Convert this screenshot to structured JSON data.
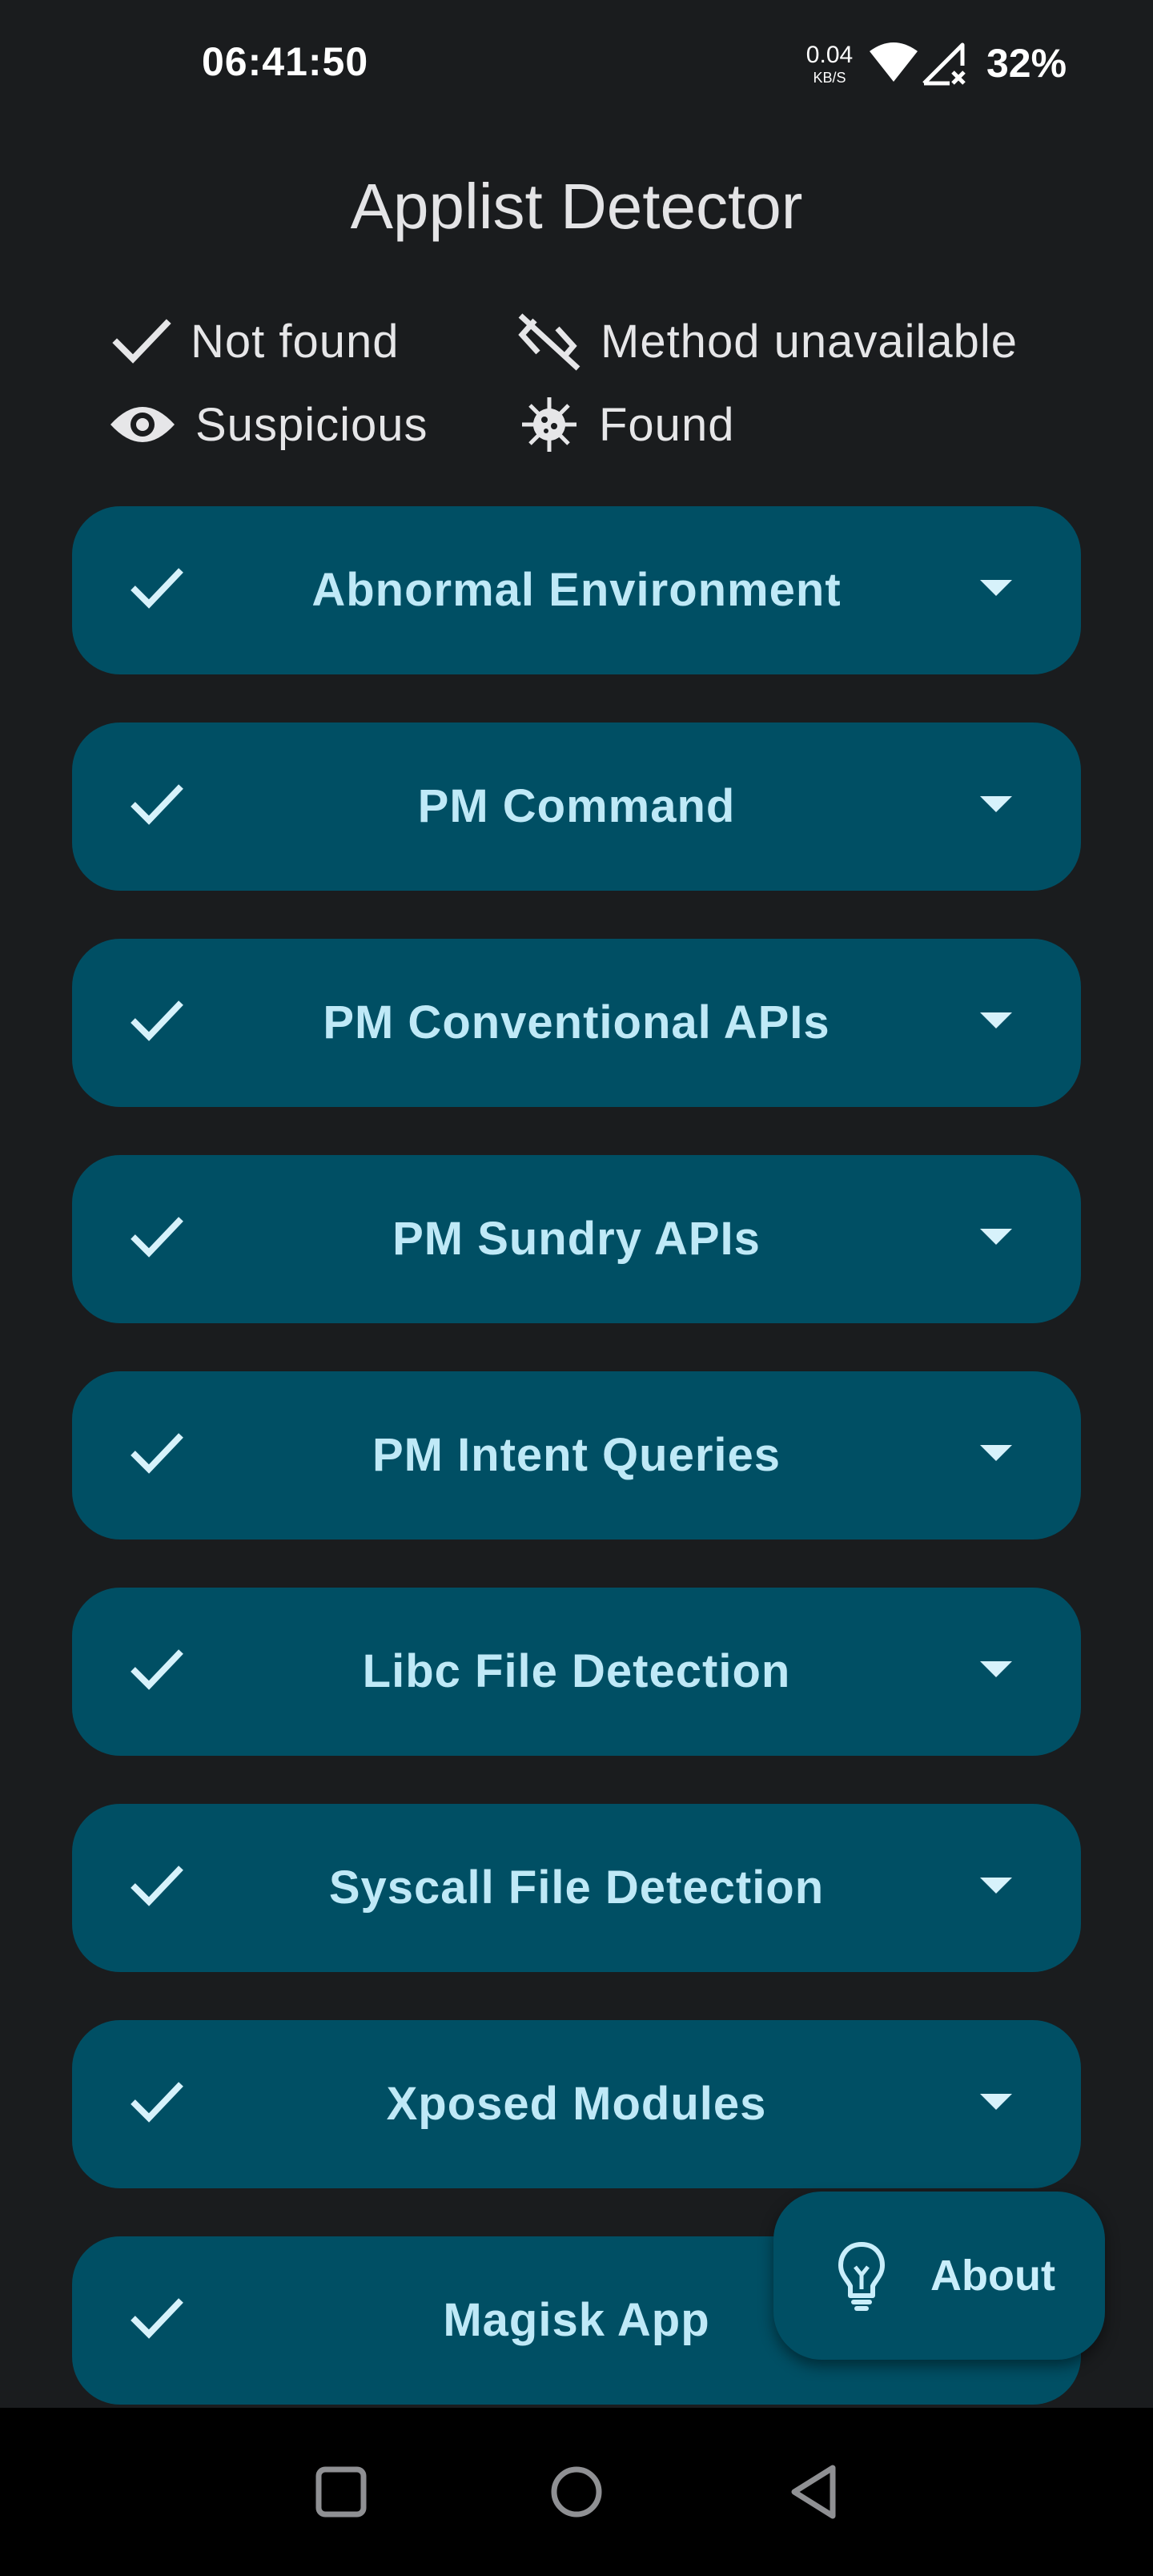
{
  "status_bar": {
    "time": "06:41:50",
    "net_speed_value": "0.04",
    "net_speed_unit": "KB/S",
    "battery": "32%",
    "icons": [
      "wifi-icon",
      "signal-icon"
    ]
  },
  "title": "Applist Detector",
  "legend": [
    {
      "icon": "check-icon",
      "label": "Not found"
    },
    {
      "icon": "code-off-icon",
      "label": "Method unavailable"
    },
    {
      "icon": "eye-icon",
      "label": "Suspicious"
    },
    {
      "icon": "virus-icon",
      "label": "Found"
    }
  ],
  "cards": [
    {
      "title": "Abnormal Environment",
      "status_icon": "check-icon"
    },
    {
      "title": "PM Command",
      "status_icon": "check-icon"
    },
    {
      "title": "PM Conventional APIs",
      "status_icon": "check-icon"
    },
    {
      "title": "PM Sundry APIs",
      "status_icon": "check-icon"
    },
    {
      "title": "PM Intent Queries",
      "status_icon": "check-icon"
    },
    {
      "title": "Libc File Detection",
      "status_icon": "check-icon"
    },
    {
      "title": "Syscall File Detection",
      "status_icon": "check-icon"
    },
    {
      "title": "Xposed Modules",
      "status_icon": "check-icon"
    },
    {
      "title": "Magisk App",
      "status_icon": "check-icon"
    }
  ],
  "fab": {
    "label": "About",
    "icon": "lightbulb-icon"
  },
  "nav_bar": {
    "buttons": [
      "recents-square-icon",
      "home-circle-icon",
      "back-triangle-icon"
    ]
  },
  "colors": {
    "background": "#1a1c1e",
    "card": "#004f64",
    "card_text": "#bfe9f7",
    "nav_bar": "#000000"
  }
}
